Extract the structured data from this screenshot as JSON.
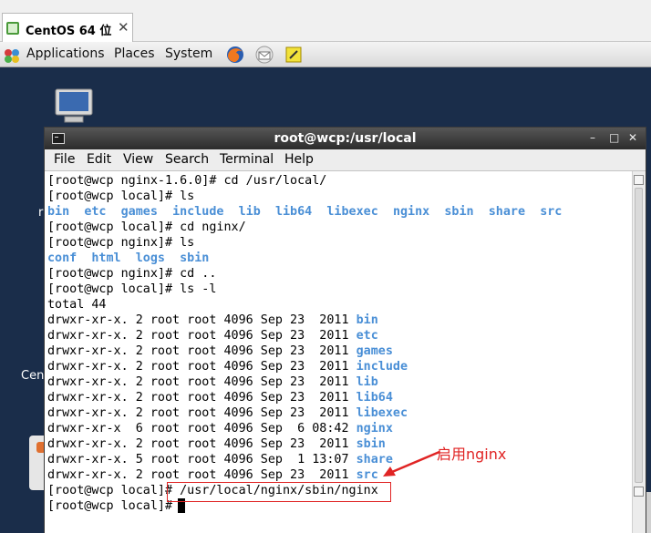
{
  "vm_tab": {
    "label": "CentOS 64 位",
    "close_glyph": "✕"
  },
  "panel": {
    "menus": [
      "Applications",
      "Places",
      "System"
    ],
    "launchers": [
      "firefox-icon",
      "mail-icon",
      "notes-icon"
    ]
  },
  "desktop": {
    "partial_text_1": "r",
    "partial_text_2": "Cen"
  },
  "terminal": {
    "title": "root@wcp:/usr/local",
    "wm_buttons": {
      "minimize": "–",
      "maximize": "□",
      "close": "✕"
    },
    "menu": [
      "File",
      "Edit",
      "View",
      "Search",
      "Terminal",
      "Help"
    ],
    "lines": [
      {
        "segments": [
          {
            "text": "[root@wcp nginx-1.6.0]# cd /usr/local/"
          }
        ]
      },
      {
        "segments": [
          {
            "text": "[root@wcp local]# ls"
          }
        ]
      },
      {
        "segments": [
          {
            "text": "bin",
            "dir": true
          },
          {
            "text": "  "
          },
          {
            "text": "etc",
            "dir": true
          },
          {
            "text": "  "
          },
          {
            "text": "games",
            "dir": true
          },
          {
            "text": "  "
          },
          {
            "text": "include",
            "dir": true
          },
          {
            "text": "  "
          },
          {
            "text": "lib",
            "dir": true
          },
          {
            "text": "  "
          },
          {
            "text": "lib64",
            "dir": true
          },
          {
            "text": "  "
          },
          {
            "text": "libexec",
            "dir": true
          },
          {
            "text": "  "
          },
          {
            "text": "nginx",
            "dir": true
          },
          {
            "text": "  "
          },
          {
            "text": "sbin",
            "dir": true
          },
          {
            "text": "  "
          },
          {
            "text": "share",
            "dir": true
          },
          {
            "text": "  "
          },
          {
            "text": "src",
            "dir": true
          }
        ]
      },
      {
        "segments": [
          {
            "text": "[root@wcp local]# cd nginx/"
          }
        ]
      },
      {
        "segments": [
          {
            "text": "[root@wcp nginx]# ls"
          }
        ]
      },
      {
        "segments": [
          {
            "text": "conf",
            "dir": true
          },
          {
            "text": "  "
          },
          {
            "text": "html",
            "dir": true
          },
          {
            "text": "  "
          },
          {
            "text": "logs",
            "dir": true
          },
          {
            "text": "  "
          },
          {
            "text": "sbin",
            "dir": true
          }
        ]
      },
      {
        "segments": [
          {
            "text": "[root@wcp nginx]# cd .."
          }
        ]
      },
      {
        "segments": [
          {
            "text": "[root@wcp local]# ls -l"
          }
        ]
      },
      {
        "segments": [
          {
            "text": "total 44"
          }
        ]
      },
      {
        "segments": [
          {
            "text": "drwxr-xr-x. 2 root root 4096 Sep 23  2011 "
          },
          {
            "text": "bin",
            "dir": true
          }
        ]
      },
      {
        "segments": [
          {
            "text": "drwxr-xr-x. 2 root root 4096 Sep 23  2011 "
          },
          {
            "text": "etc",
            "dir": true
          }
        ]
      },
      {
        "segments": [
          {
            "text": "drwxr-xr-x. 2 root root 4096 Sep 23  2011 "
          },
          {
            "text": "games",
            "dir": true
          }
        ]
      },
      {
        "segments": [
          {
            "text": "drwxr-xr-x. 2 root root 4096 Sep 23  2011 "
          },
          {
            "text": "include",
            "dir": true
          }
        ]
      },
      {
        "segments": [
          {
            "text": "drwxr-xr-x. 2 root root 4096 Sep 23  2011 "
          },
          {
            "text": "lib",
            "dir": true
          }
        ]
      },
      {
        "segments": [
          {
            "text": "drwxr-xr-x. 2 root root 4096 Sep 23  2011 "
          },
          {
            "text": "lib64",
            "dir": true
          }
        ]
      },
      {
        "segments": [
          {
            "text": "drwxr-xr-x. 2 root root 4096 Sep 23  2011 "
          },
          {
            "text": "libexec",
            "dir": true
          }
        ]
      },
      {
        "segments": [
          {
            "text": "drwxr-xr-x  6 root root 4096 Sep  6 08:42 "
          },
          {
            "text": "nginx",
            "dir": true
          }
        ]
      },
      {
        "segments": [
          {
            "text": "drwxr-xr-x. 2 root root 4096 Sep 23  2011 "
          },
          {
            "text": "sbin",
            "dir": true
          }
        ]
      },
      {
        "segments": [
          {
            "text": "drwxr-xr-x. 5 root root 4096 Sep  1 13:07 "
          },
          {
            "text": "share",
            "dir": true
          }
        ]
      },
      {
        "segments": [
          {
            "text": "drwxr-xr-x. 2 root root 4096 Sep 23  2011 "
          },
          {
            "text": "src",
            "dir": true
          }
        ]
      },
      {
        "segments": [
          {
            "text": "[root@wcp local]# /usr/local/nginx/sbin/nginx"
          }
        ]
      },
      {
        "segments": [
          {
            "text": "[root@wcp local]# "
          }
        ]
      }
    ]
  },
  "annotation": {
    "label": "启用nginx",
    "color": "#e02424"
  },
  "colors": {
    "directory": "#4a8fd6",
    "desktop": "#1a2d4a"
  }
}
